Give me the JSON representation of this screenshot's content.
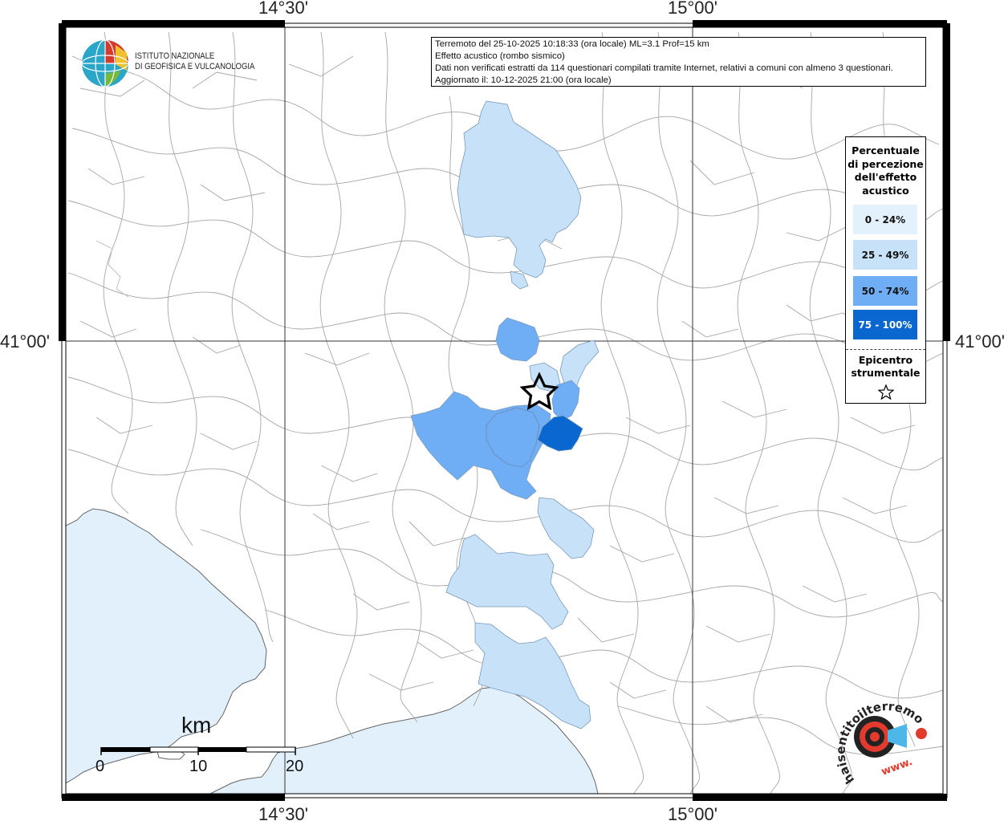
{
  "map": {
    "longitude_labels": [
      "14°30'",
      "15°00'"
    ],
    "latitude_labels": [
      "41°00'"
    ],
    "colors": {
      "sea": "#e1f0fb",
      "land": "#ffffff",
      "borders": "#9a9a9a",
      "frame": "#000000",
      "grid": "#333333"
    }
  },
  "info": {
    "line1": "Terremoto del 25-10-2025 10:18:33 (ora locale) ML=3.1 Prof=15 km",
    "line2": "Effetto acustico (rombo sismico)",
    "line3": "Dati non verificati estratti da 114 questionari compilati tramite Internet, relativi a comuni con almeno 3 questionari.",
    "line4": "Aggiornato il: 10-12-2025 21:00 (ora locale)"
  },
  "legend": {
    "title": "Percentuale di percezione dell'effetto acustico",
    "classes": [
      {
        "label": "0 - 24%",
        "color": "#e3f1fd"
      },
      {
        "label": "25 - 49%",
        "color": "#c7e1f9"
      },
      {
        "label": "50 - 74%",
        "color": "#6faef5"
      },
      {
        "label": "75 - 100%",
        "color": "#0a67cf"
      }
    ],
    "epicenter_label": "Epicentro strumentale",
    "epicenter_icon": "star-outline-icon"
  },
  "logos": {
    "ingv_name": [
      "ISTITUTO NAZIONALE",
      "DI GEOFISICA E VULCANOLOGIA"
    ],
    "hst_text": "haisentitoilterremoto.it",
    "hst_www": "www."
  },
  "scale_bar": {
    "unit": "km",
    "ticks": [
      "0",
      "10",
      "20"
    ]
  }
}
